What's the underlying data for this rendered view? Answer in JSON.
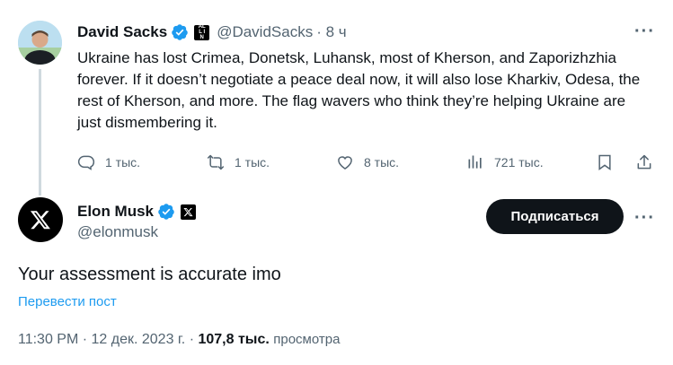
{
  "original_tweet": {
    "author_name": "David Sacks",
    "handle": "@DavidSacks",
    "time": "· 8 ч",
    "affiliate_badge": "ALL IN",
    "text": "Ukraine has lost Crimea, Donetsk, Luhansk, most of Kherson, and Zaporizhzhia forever. If it doesn’t negotiate a peace deal now, it will also lose Kharkiv, Odesa, the rest of Kherson, and more. The flag wavers who think they’re helping Ukraine are just dismembering it.",
    "actions": {
      "replies": "1 тыс.",
      "reposts": "1 тыс.",
      "likes": "8 тыс.",
      "views": "721 тыс."
    },
    "more": "···"
  },
  "reply_tweet": {
    "author_name": "Elon Musk",
    "handle": "@elonmusk",
    "subscribe_label": "Подписаться",
    "more": "···",
    "text": "Your assessment is accurate imo",
    "translate_label": "Перевести пост",
    "timestamp": "11:30 PM · 12 дек. 2023 г. · ",
    "view_count": "107,8 тыс.",
    "views_label": "просмотра"
  },
  "colors": {
    "verified": "#1d9bf0",
    "link": "#1d9bf0",
    "secondary_text": "#536471",
    "thread_line": "#cfd9de",
    "button_bg": "#0f1419"
  }
}
